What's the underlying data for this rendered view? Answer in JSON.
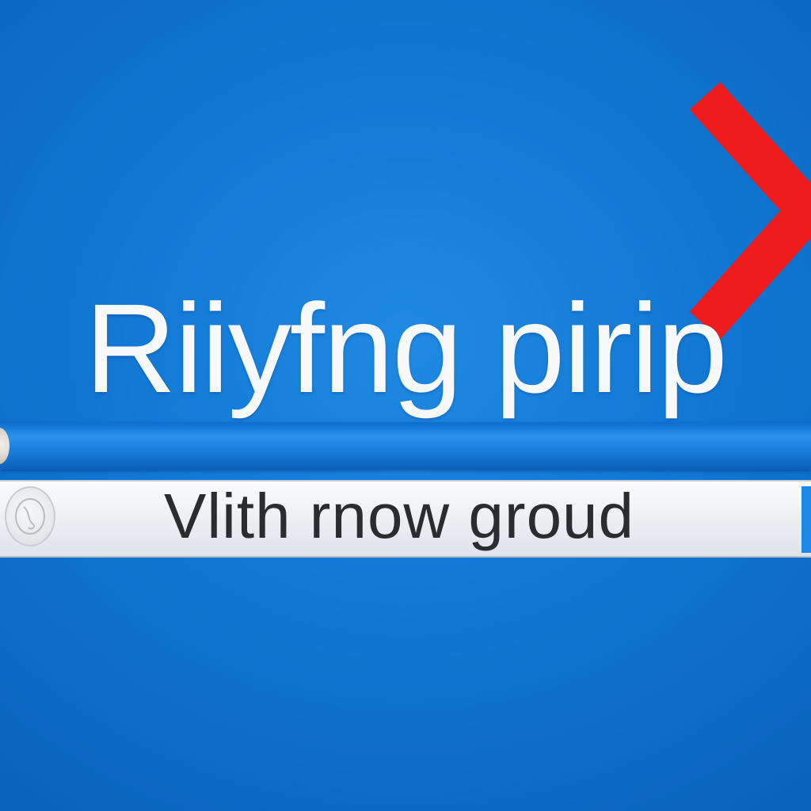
{
  "headline": "Riiyfng pirip",
  "search_bar": {
    "text": "Vlith rnow groud",
    "icon": "globe-icon"
  },
  "arrow": {
    "icon": "chevron-right-icon",
    "color": "#ee1c1c"
  },
  "colors": {
    "background": "#1178d4",
    "headline_text": "#f7f9fb",
    "bar_text": "#2a2c2f",
    "accent": "#1a8ae6"
  }
}
